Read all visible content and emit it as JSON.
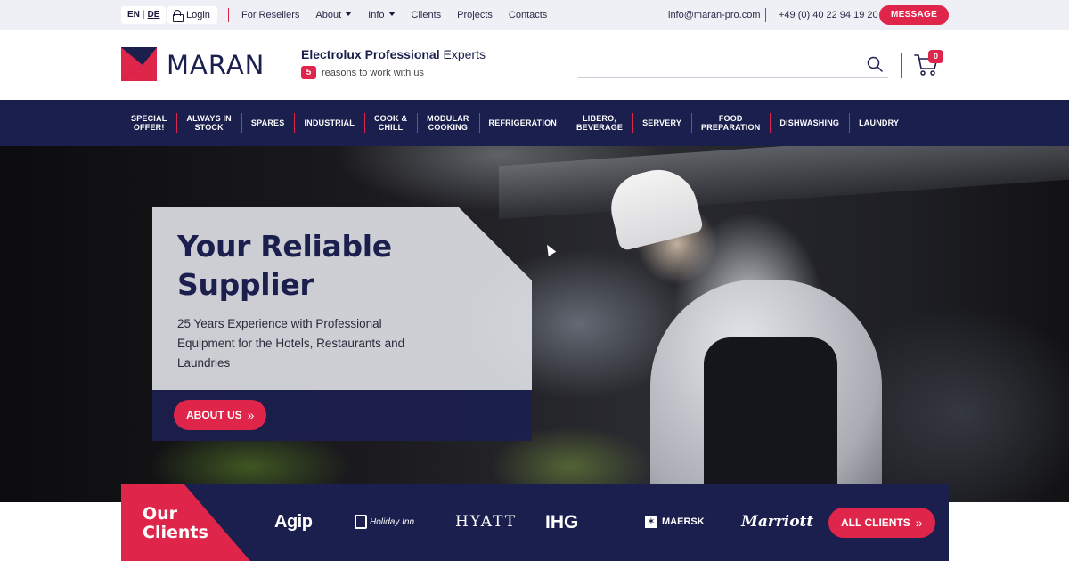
{
  "topbar": {
    "lang_en": "EN",
    "lang_sep": "|",
    "lang_de": "DE",
    "login_label": "Login",
    "nav": [
      {
        "label": "For Resellers",
        "dropdown": false
      },
      {
        "label": "About",
        "dropdown": true
      },
      {
        "label": "Info",
        "dropdown": true
      },
      {
        "label": "Clients",
        "dropdown": false
      },
      {
        "label": "Projects",
        "dropdown": false
      },
      {
        "label": "Contacts",
        "dropdown": false
      }
    ],
    "email": "info@maran-pro.com",
    "phone": "+49 (0) 40 22 94 19 20",
    "message_button": "MESSAGE"
  },
  "header": {
    "logo_text": "MARAN",
    "tagline_bold": "Electrolux Professional",
    "tagline_rest": " Experts",
    "reasons_number": "5",
    "reasons_text": "reasons to work with us",
    "search_placeholder": "",
    "cart_count": "0"
  },
  "categories": [
    "SPECIAL\nOFFER!",
    "ALWAYS IN\nSTOCK",
    "SPARES",
    "INDUSTRIAL",
    "COOK &\nCHILL",
    "MODULAR\nCOOKING",
    "REFRIGERATION",
    "LIBERO,\nBEVERAGE",
    "SERVERY",
    "FOOD\nPREPARATION",
    "DISHWASHING",
    "LAUNDRY"
  ],
  "hero": {
    "title_line1": "Your Reliable",
    "title_line2": "Supplier",
    "subtitle": "25 Years Experience with Professional Equipment for the Hotels, Restaurants and Laundries",
    "button": "ABOUT US"
  },
  "clients": {
    "title_line1": "Our",
    "title_line2": "Clients",
    "logos": [
      "Agip",
      "Holiday Inn",
      "HYATT",
      "IHG",
      "MAERSK",
      "Marriott"
    ],
    "all_button": "ALL CLIENTS"
  },
  "colors": {
    "brand_navy": "#1b1f4e",
    "brand_red": "#e0254a"
  }
}
